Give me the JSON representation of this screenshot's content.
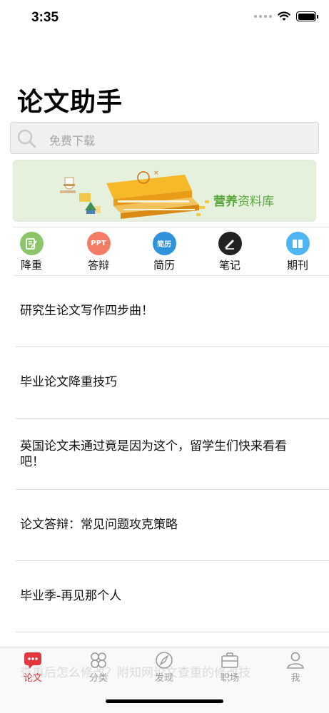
{
  "status_bar": {
    "time": "3:35"
  },
  "header": {
    "title": "论文助手"
  },
  "search": {
    "placeholder": "免费下载"
  },
  "banner": {
    "brand": "营养",
    "text": "资料库"
  },
  "shortcuts": [
    {
      "label": "降重",
      "icon": "edit-doc-icon",
      "color": "#8cc56a"
    },
    {
      "label": "答辩",
      "icon": "ppt-icon",
      "badge": "PPT",
      "color": "#f47c66"
    },
    {
      "label": "简历",
      "icon": "resume-icon",
      "badge": "简历",
      "color": "#2f92dc"
    },
    {
      "label": "笔记",
      "icon": "pen-icon",
      "color": "#222222"
    },
    {
      "label": "期刊",
      "icon": "book-icon",
      "color": "#4fb4f2"
    }
  ],
  "articles": [
    {
      "title": "研究生论文写作四步曲！"
    },
    {
      "title": "毕业论文降重技巧"
    },
    {
      "title": "英国论文未通过竟是因为这个，留学生们快来看看吧！"
    },
    {
      "title": "论文答辩：常见问题攻克策略"
    },
    {
      "title": "毕业季-再见那个人"
    }
  ],
  "partial_article": "查重后怎么修改？附知网论文查重的修改技",
  "tabbar": {
    "tabs": [
      {
        "label": "论文",
        "icon": "message-icon",
        "active": true
      },
      {
        "label": "分类",
        "icon": "grid-icon",
        "active": false
      },
      {
        "label": "发现",
        "icon": "compass-icon",
        "active": false
      },
      {
        "label": "职场",
        "icon": "briefcase-icon",
        "active": false
      },
      {
        "label": "我",
        "icon": "person-icon",
        "active": false
      }
    ]
  },
  "colors": {
    "accent": "#e0383e",
    "inactive": "#9a9a9a",
    "banner_green": "#57a83a"
  }
}
